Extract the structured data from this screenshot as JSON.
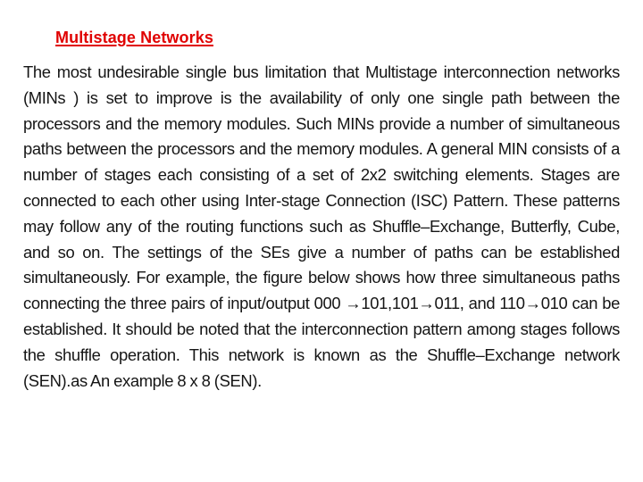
{
  "slide": {
    "title": "Multistage Networks",
    "paragraph": "The most undesirable single bus limitation that Multistage interconnection networks (MINs ) is set to improve is the availability of only one single path between the processors and the memory modules. Such MINs provide a number of simultaneous paths between the processors and the memory modules. A general MIN consists of a number of stages each consisting of a set of 2x2 switching elements. Stages are connected to each other using Inter-stage Connection (ISC) Pattern. These patterns may follow any of the routing functions such as Shuffle–Exchange, Butterfly, Cube, and so on. The settings of the SEs give a number of paths can be established simultaneously. For example, the figure below shows how three simultaneous paths connecting the three pairs of input/output 000 →101,101→011, and 110→010 can be established. It should be noted that the interconnection pattern among stages follows the shuffle operation. This network is known as the Shuffle–Exchange network (SEN).as An example 8 x 8 (SEN).",
    "colors": {
      "title": "#e00000",
      "text": "#151515",
      "background": "#ffffff"
    }
  }
}
